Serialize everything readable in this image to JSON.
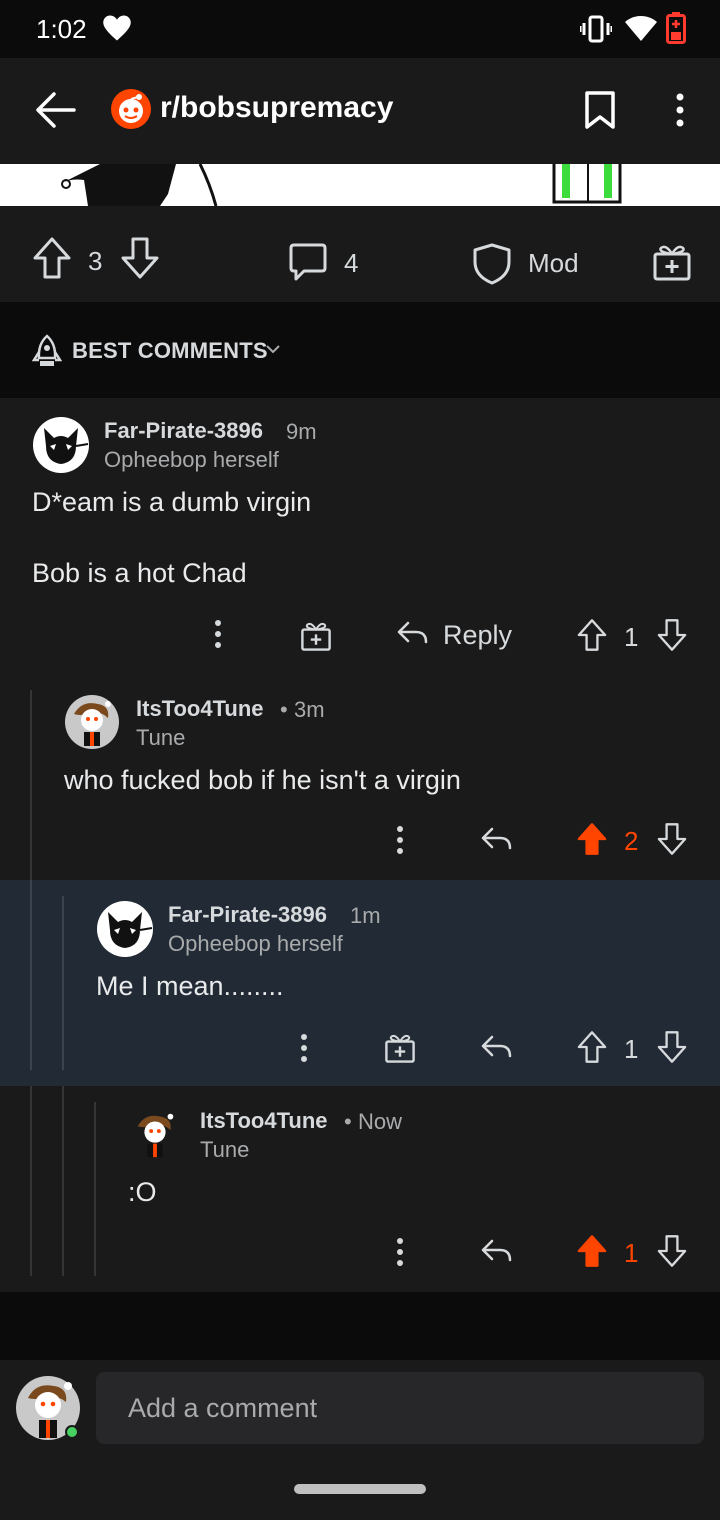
{
  "status_bar": {
    "time": "1:02"
  },
  "header": {
    "subreddit": "r/bobsupremacy"
  },
  "post_actions": {
    "score": "3",
    "comments_count": "4",
    "mod_label": "Mod"
  },
  "sort": {
    "label": "BEST COMMENTS"
  },
  "comments": [
    {
      "author": "Far-Pirate-3896",
      "time": "9m",
      "flair": "Opheebop herself",
      "body_line1": "D*eam is a dumb virgin",
      "body_line2": "Bob is a hot Chad",
      "reply_label": "Reply",
      "score": "1"
    },
    {
      "author": "ItsToo4Tune",
      "time": "3m",
      "flair": "Tune",
      "body": "who fucked bob if he isn't a virgin",
      "score": "2"
    },
    {
      "author": "Far-Pirate-3896",
      "time": "1m",
      "flair": "Opheebop herself",
      "body": "Me I mean........",
      "score": "1"
    },
    {
      "author": "ItsToo4Tune",
      "time": "Now",
      "flair": "Tune",
      "body": ":O",
      "score": "1"
    }
  ],
  "composer": {
    "placeholder": "Add a comment"
  },
  "colors": {
    "upvoted": "#ff4500",
    "highlight_bg": "#222a35",
    "surface": "#1a1a1b"
  }
}
